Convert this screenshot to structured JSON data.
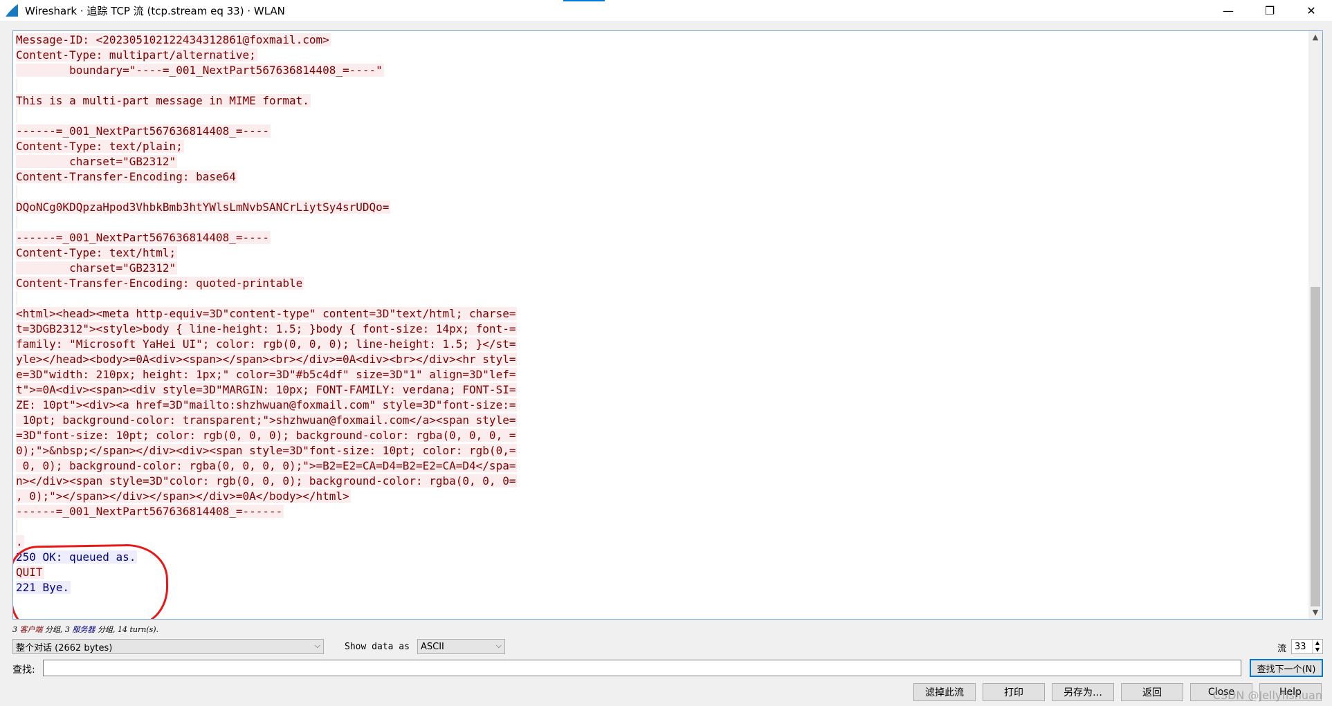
{
  "window": {
    "title": "Wireshark · 追踪 TCP 流 (tcp.stream eq 33) · WLAN",
    "minimize": "—",
    "maximize": "❐",
    "close": "✕"
  },
  "stream_lines": [
    {
      "dir": "client",
      "text": "Message-ID: <202305102122434312861@foxmail.com>"
    },
    {
      "dir": "client",
      "text": "Content-Type: multipart/alternative;"
    },
    {
      "dir": "client",
      "text": "        boundary=\"----=_001_NextPart567636814408_=----\""
    },
    {
      "dir": "client",
      "text": ""
    },
    {
      "dir": "client",
      "text": "This is a multi-part message in MIME format."
    },
    {
      "dir": "client",
      "text": ""
    },
    {
      "dir": "client",
      "text": "------=_001_NextPart567636814408_=----"
    },
    {
      "dir": "client",
      "text": "Content-Type: text/plain;"
    },
    {
      "dir": "client",
      "text": "        charset=\"GB2312\""
    },
    {
      "dir": "client",
      "text": "Content-Transfer-Encoding: base64"
    },
    {
      "dir": "client",
      "text": ""
    },
    {
      "dir": "client",
      "text": "DQoNCg0KDQpzaHpod3VhbkBmb3htYWlsLmNvbSANCrLiytSy4srUDQo="
    },
    {
      "dir": "client",
      "text": ""
    },
    {
      "dir": "client",
      "text": "------=_001_NextPart567636814408_=----"
    },
    {
      "dir": "client",
      "text": "Content-Type: text/html;"
    },
    {
      "dir": "client",
      "text": "        charset=\"GB2312\""
    },
    {
      "dir": "client",
      "text": "Content-Transfer-Encoding: quoted-printable"
    },
    {
      "dir": "client",
      "text": ""
    },
    {
      "dir": "client",
      "text": "<html><head><meta http-equiv=3D\"content-type\" content=3D\"text/html; charse="
    },
    {
      "dir": "client",
      "text": "t=3DGB2312\"><style>body { line-height: 1.5; }body { font-size: 14px; font-="
    },
    {
      "dir": "client",
      "text": "family: \"Microsoft YaHei UI\"; color: rgb(0, 0, 0); line-height: 1.5; }</st="
    },
    {
      "dir": "client",
      "text": "yle></head><body>=0A<div><span></span><br></div>=0A<div><br></div><hr styl="
    },
    {
      "dir": "client",
      "text": "e=3D\"width: 210px; height: 1px;\" color=3D\"#b5c4df\" size=3D\"1\" align=3D\"lef="
    },
    {
      "dir": "client",
      "text": "t\">=0A<div><span><div style=3D\"MARGIN: 10px; FONT-FAMILY: verdana; FONT-SI="
    },
    {
      "dir": "client",
      "text": "ZE: 10pt\"><div><a href=3D\"mailto:shzhwuan@foxmail.com\" style=3D\"font-size:="
    },
    {
      "dir": "client",
      "text": " 10pt; background-color: transparent;\">shzhwuan@foxmail.com</a><span style="
    },
    {
      "dir": "client",
      "text": "=3D\"font-size: 10pt; color: rgb(0, 0, 0); background-color: rgba(0, 0, 0, ="
    },
    {
      "dir": "client",
      "text": "0);\">&nbsp;</span></div><div><span style=3D\"font-size: 10pt; color: rgb(0,="
    },
    {
      "dir": "client",
      "text": " 0, 0); background-color: rgba(0, 0, 0, 0);\">=B2=E2=CA=D4=B2=E2=CA=D4</spa="
    },
    {
      "dir": "client",
      "text": "n></div><span style=3D\"color: rgb(0, 0, 0); background-color: rgba(0, 0, 0="
    },
    {
      "dir": "client",
      "text": ", 0);\"></span></div></span></div>=0A</body></html>"
    },
    {
      "dir": "client",
      "text": "------=_001_NextPart567636814408_=------"
    },
    {
      "dir": "client",
      "text": ""
    },
    {
      "dir": "client",
      "text": "."
    },
    {
      "dir": "server",
      "text": "250 OK: queued as."
    },
    {
      "dir": "client",
      "text": "QUIT"
    },
    {
      "dir": "server",
      "text": "221 Bye."
    }
  ],
  "status": {
    "prefix": "3",
    "client_label": "客户端",
    "mid1": "分组, 3",
    "server_label": "服务器",
    "mid2": "分组, 14 turn(s)."
  },
  "controls": {
    "conversation_select": "整个对话 (2662 bytes)",
    "show_data_label": "Show data as",
    "show_data_select": "ASCII",
    "stream_label": "流",
    "stream_value": "33",
    "find_label": "查找:",
    "find_value": "",
    "find_next": "查找下一个(N)",
    "filter_out": "滤掉此流",
    "print": "打印",
    "save_as": "另存为…",
    "back": "返回",
    "close": "Close",
    "help": "Help"
  },
  "watermark": "CSDN @Jellyfishuan",
  "colors": {
    "client_text": "#7f0000",
    "client_bg": "#fbeded",
    "server_text": "#00007f",
    "server_bg": "#ededfb",
    "annotation": "#e81818"
  }
}
